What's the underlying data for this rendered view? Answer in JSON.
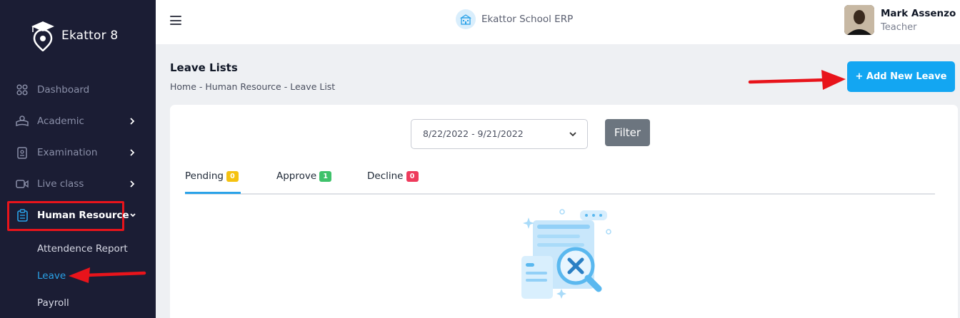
{
  "brand": {
    "name": "Ekattor 8"
  },
  "sidebar": {
    "items": [
      {
        "label": "Dashboard",
        "icon": "dashboard-icon"
      },
      {
        "label": "Academic",
        "icon": "academic-icon"
      },
      {
        "label": "Examination",
        "icon": "examination-icon"
      },
      {
        "label": "Live class",
        "icon": "video-icon"
      },
      {
        "label": "Human Resource",
        "icon": "clipboard-icon"
      }
    ],
    "submenu": [
      {
        "label": "Attendence Report"
      },
      {
        "label": "Leave"
      },
      {
        "label": "Payroll"
      }
    ]
  },
  "header": {
    "app_title": "Ekattor School ERP",
    "user_name": "Mark Assenzo",
    "user_role": "Teacher"
  },
  "page": {
    "title": "Leave Lists",
    "breadcrumb": "Home - Human Resource - Leave List",
    "add_button": "+ Add New Leave"
  },
  "filter": {
    "date_range": "8/22/2022  - 9/21/2022",
    "button": "Filter"
  },
  "tabs": [
    {
      "label": "Pending",
      "count": "0",
      "color": "#f5c211"
    },
    {
      "label": "Approve",
      "count": "1",
      "color": "#3fc26b"
    },
    {
      "label": "Decline",
      "count": "0",
      "color": "#ee3b5c"
    }
  ],
  "colors": {
    "sidebar_bg": "#1b1d34",
    "accent": "#13a6f2",
    "annotation_red": "#e8141b"
  }
}
